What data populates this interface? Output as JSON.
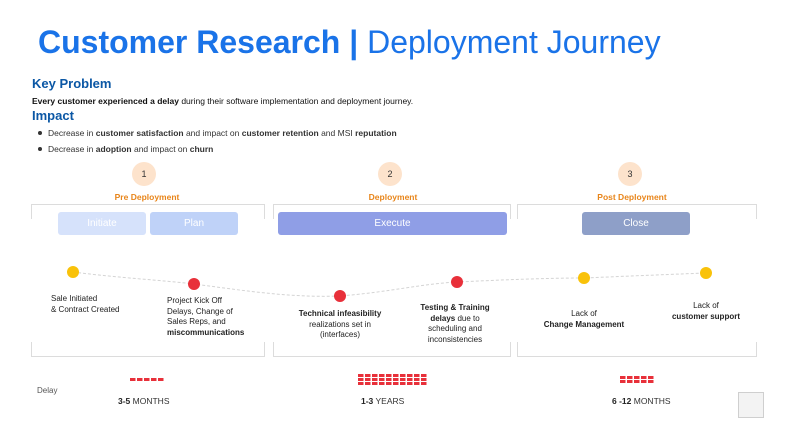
{
  "title": {
    "strong": "Customer Research",
    "separator": "|",
    "light": "Deployment Journey"
  },
  "key_problem": {
    "heading": "Key Problem",
    "bold_part": "Every customer experienced a delay",
    "rest": " during their software implementation and deployment journey."
  },
  "impact": {
    "heading": "Impact",
    "bullets": [
      {
        "pre": "Decrease in ",
        "b1": "customer satisfaction",
        "mid": " and impact on ",
        "b2": "customer retention",
        "mid2": " and MSI ",
        "b3": "reputation"
      },
      {
        "pre": "Decrease in ",
        "b1": "adoption",
        "mid": " and impact on ",
        "b2": "churn"
      }
    ]
  },
  "phases": [
    {
      "number": "1",
      "title": "Pre Deployment"
    },
    {
      "number": "2",
      "title": "Deployment"
    },
    {
      "number": "3",
      "title": "Post Deployment"
    }
  ],
  "stages": [
    {
      "label": "Initiate",
      "color": "#d6e2fb"
    },
    {
      "label": "Plan",
      "color": "#bfd2f8"
    },
    {
      "label": "Execute",
      "color": "#8f9ee6"
    },
    {
      "label": "Close",
      "color": "#8e9fc8"
    }
  ],
  "nodes": [
    {
      "color": "yellow",
      "line1": "Sale Initiated",
      "line2": "& Contract Created"
    },
    {
      "color": "red",
      "line1": "Project Kick Off",
      "line2": "Delays, Change of",
      "line3": "Sales Reps, and",
      "bold": "miscommunications"
    },
    {
      "color": "red",
      "bold": "Technical infeasibility",
      "line2": "realizations set in",
      "line3": "(interfaces)"
    },
    {
      "color": "red",
      "bold": "Testing & Training",
      "bold2": "delays",
      "line1": " due to",
      "line2": "scheduling and",
      "line3": "inconsistencies"
    },
    {
      "color": "yellow",
      "line1": "Lack of",
      "bold": "Change Management"
    },
    {
      "color": "yellow",
      "line1": "Lack of",
      "bold": "customer support"
    }
  ],
  "delay": {
    "label": "Delay",
    "durations": [
      {
        "value": "3-5",
        "unit": " MONTHS"
      },
      {
        "value": "1-3",
        "unit": " YEARS"
      },
      {
        "value": "6 -12",
        "unit": " MONTHS"
      }
    ],
    "bar_color": "#e8303a"
  }
}
